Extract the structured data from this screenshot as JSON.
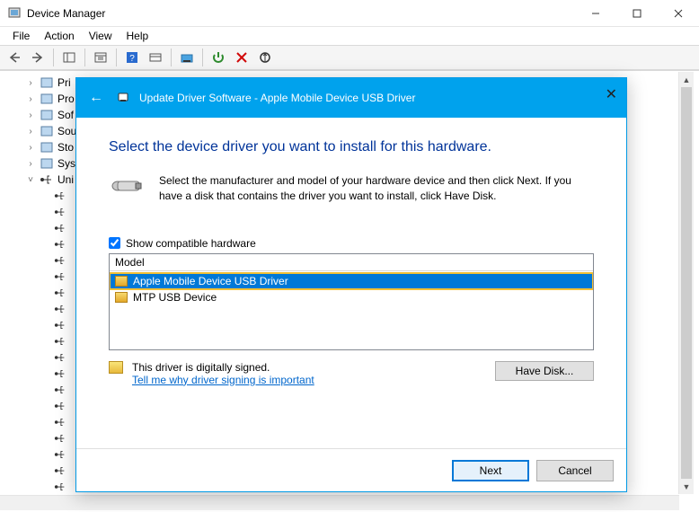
{
  "window": {
    "title": "Device Manager"
  },
  "menu": {
    "file": "File",
    "action": "Action",
    "view": "View",
    "help": "Help"
  },
  "tree": {
    "items": [
      {
        "label": "Pri",
        "icon": "printer"
      },
      {
        "label": "Pro",
        "icon": "cpu"
      },
      {
        "label": "Sof",
        "icon": "component"
      },
      {
        "label": "Sou",
        "icon": "sound"
      },
      {
        "label": "Sto",
        "icon": "storage"
      },
      {
        "label": "Sys",
        "icon": "system"
      }
    ],
    "expanded": {
      "label": "Uni",
      "icon": "usb"
    }
  },
  "dialog": {
    "title": "Update Driver Software - Apple Mobile Device USB Driver",
    "headline": "Select the device driver you want to install for this hardware.",
    "info": "Select the manufacturer and model of your hardware device and then click Next. If you have a disk that contains the driver you want to install, click Have Disk.",
    "compat_label": "Show compatible hardware",
    "model_header": "Model",
    "models": [
      "Apple Mobile Device USB Driver",
      "MTP USB Device"
    ],
    "signed_text": "This driver is digitally signed.",
    "signing_link": "Tell me why driver signing is important",
    "have_disk": "Have Disk...",
    "next": "Next",
    "cancel": "Cancel"
  }
}
